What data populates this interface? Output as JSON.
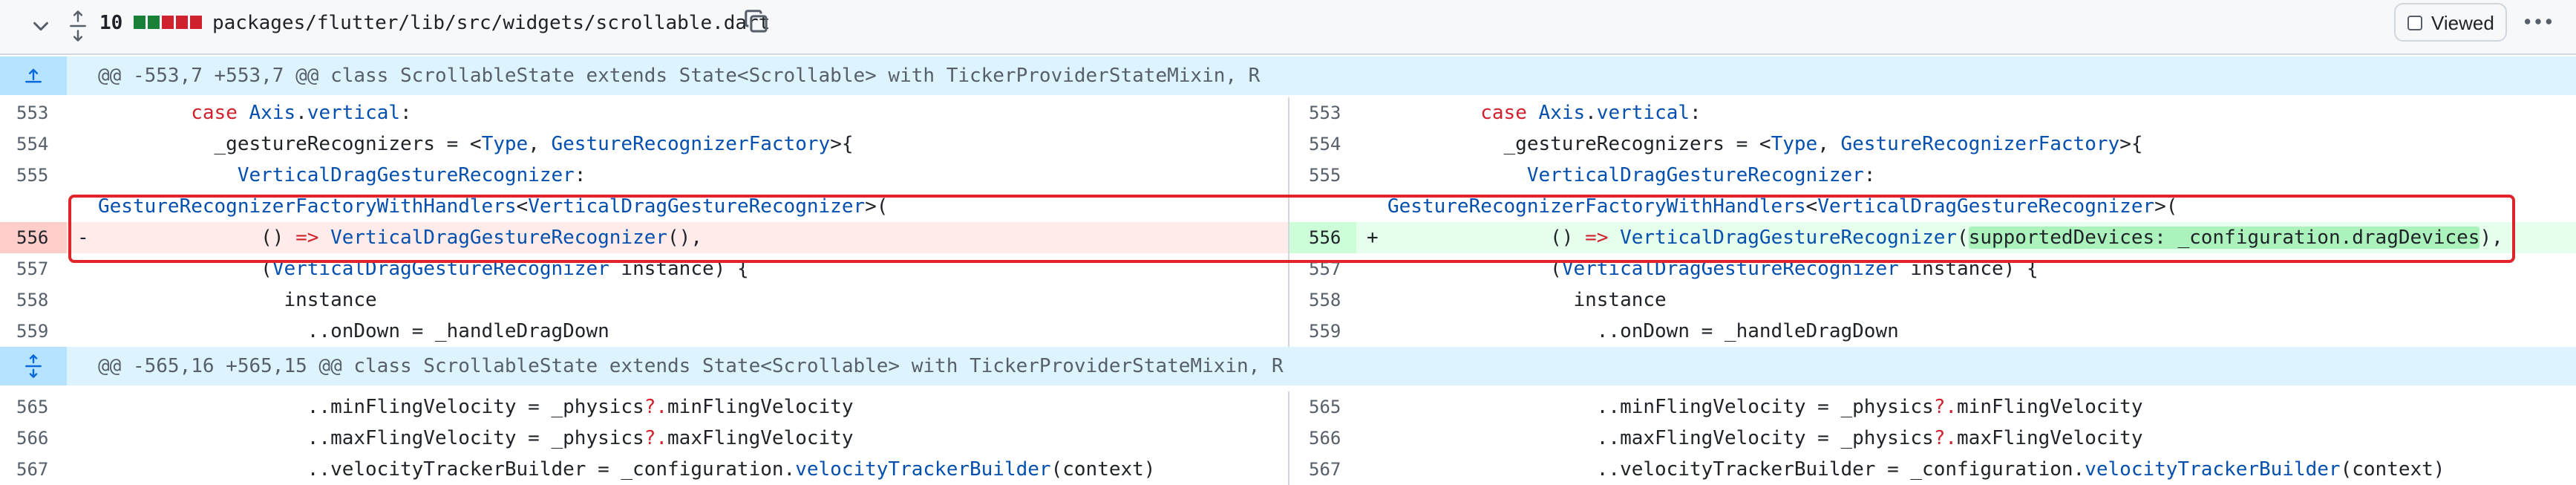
{
  "file": {
    "changed_count": "10",
    "path": "packages/flutter/lib/src/widgets/scrollable.dart",
    "viewed_label": "Viewed",
    "diffstat_colors": [
      "#1a7f37",
      "#1a7f37",
      "#cf222e",
      "#cf222e",
      "#cf222e"
    ]
  },
  "hunks": [
    {
      "header": "@@ -553,7 +553,7 @@ class ScrollableState extends State<Scrollable> with TickerProviderStateMixin, R"
    },
    {
      "header": "@@ -565,16 +565,15 @@ class ScrollableState extends State<Scrollable> with TickerProviderStateMixin, R"
    }
  ],
  "lines": {
    "l553": {
      "num": "553",
      "t1": "        case ",
      "t2": "Axis",
      "t3": ".",
      "t4": "vertical",
      "t5": ":"
    },
    "l554": {
      "num": "554",
      "t1": "          _gestureRecognizers = <",
      "t2": "Type",
      "t3": ", ",
      "t4": "GestureRecognizerFactory",
      "t5": ">{"
    },
    "l555": {
      "num": "555",
      "t1": "            ",
      "t2": "VerticalDragGestureRecognizer",
      "t3": ":"
    },
    "wrap": {
      "t1": "GestureRecognizerFactoryWithHandlers",
      "t2": "<",
      "t3": "VerticalDragGestureRecognizer",
      "t4": ">("
    },
    "del556": {
      "num": "556",
      "sign": "-",
      "t1": "              () ",
      "t2": "=>",
      "t3": " ",
      "t4": "VerticalDragGestureRecognizer",
      "t5": "(),"
    },
    "add556": {
      "num": "556",
      "sign": "+",
      "t1": "              () ",
      "t2": "=>",
      "t3": " ",
      "t4": "VerticalDragGestureRecognizer",
      "t5": "(",
      "t6": "supportedDevices: _configuration.dragDevices",
      "t7": "),"
    },
    "l557": {
      "num": "557",
      "t1": "              (",
      "t2": "VerticalDragGestureRecognizer",
      "t3": " instance) {"
    },
    "l558": {
      "num": "558",
      "t1": "                instance"
    },
    "l559": {
      "num": "559",
      "t1": "                  ..onDown = _handleDragDown"
    },
    "l565": {
      "num": "565",
      "t1": "                  ..minFlingVelocity = _physics",
      "t2": "?.",
      "t3": "minFlingVelocity"
    },
    "l566": {
      "num": "566",
      "t1": "                  ..maxFlingVelocity = _physics",
      "t2": "?.",
      "t3": "maxFlingVelocity"
    },
    "l567": {
      "num": "567",
      "t1": "                  ..velocityTrackerBuilder = _configuration.",
      "t2": "velocityTrackerBuilder",
      "t3": "(context)"
    }
  },
  "colors": {
    "deletion_bg": "#ffebe9",
    "addition_bg": "#e6ffec",
    "hunk_bg": "#ddf4ff",
    "keyword": "#cf222e",
    "type": "#0550ae",
    "annotation_box": "#e0242b"
  },
  "icons": [
    "chevron-down-icon",
    "unfold-icon",
    "copy-icon",
    "checkbox-icon",
    "kebab-horizontal-icon",
    "expand-up-icon",
    "expand-both-icon"
  ]
}
